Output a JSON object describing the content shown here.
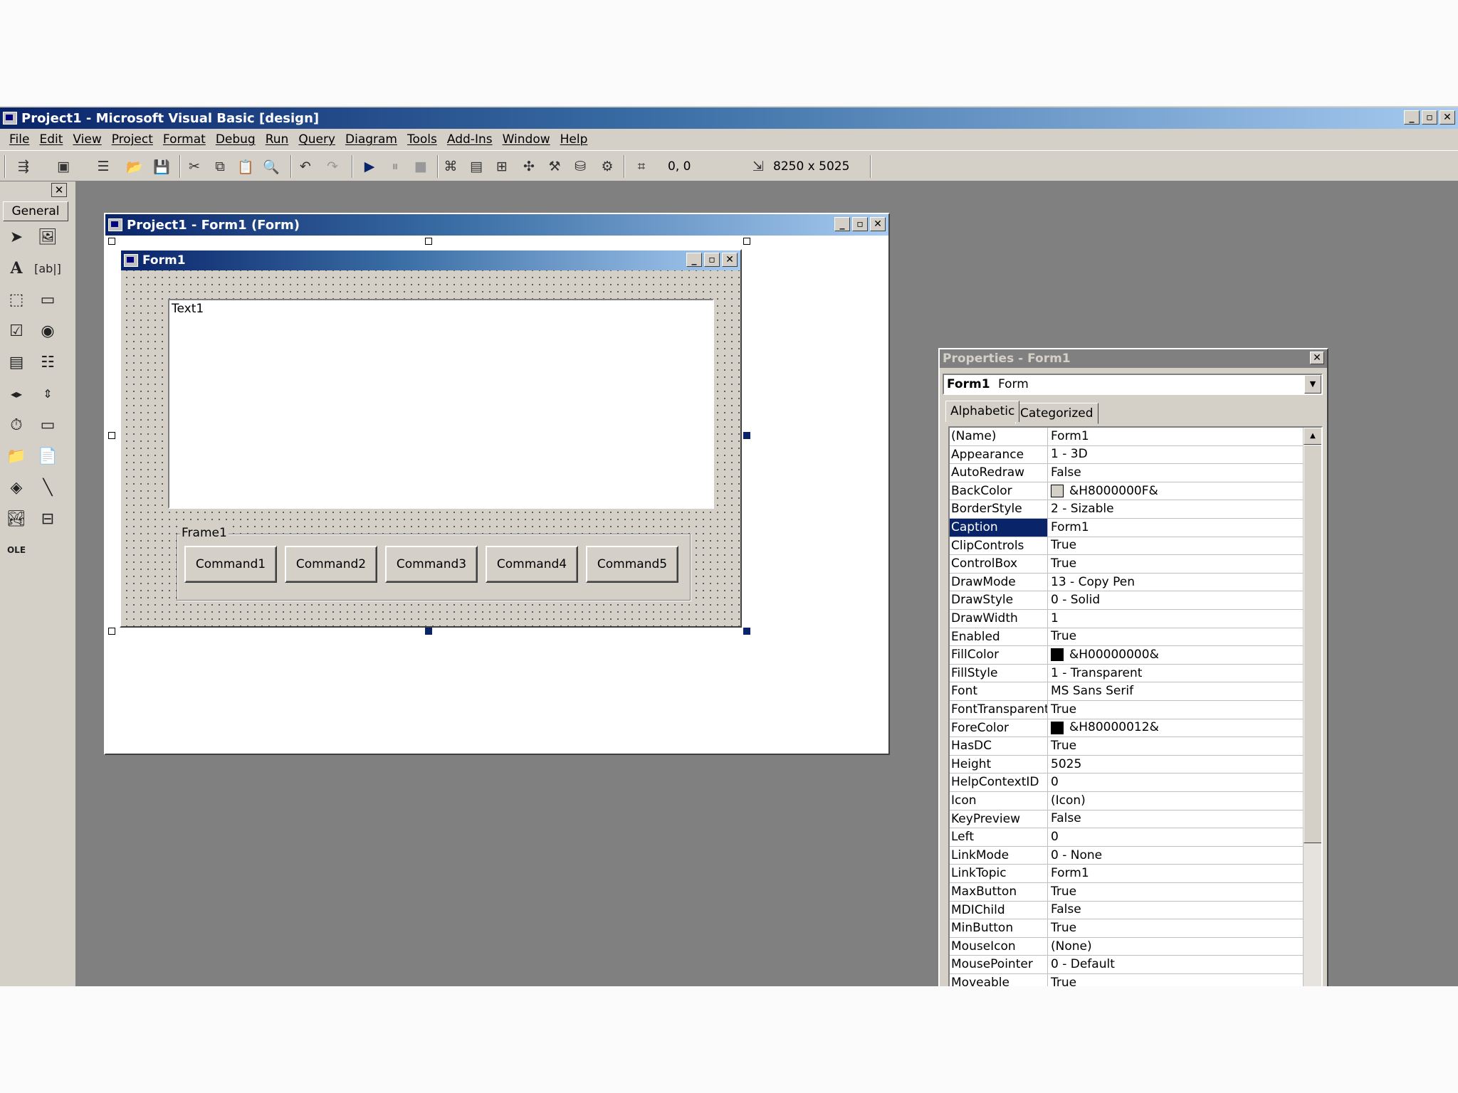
{
  "app": {
    "title": "Project1 - Microsoft Visual Basic [design]",
    "window_controls": [
      "_",
      "▫",
      "✕"
    ]
  },
  "menu": [
    "File",
    "Edit",
    "View",
    "Project",
    "Format",
    "Debug",
    "Run",
    "Query",
    "Diagram",
    "Tools",
    "Add-Ins",
    "Window",
    "Help"
  ],
  "toolbar": {
    "position_readout": "0, 0",
    "size_readout": "8250 x 5025"
  },
  "toolbox": {
    "tab_label": "General",
    "close_label": "✕"
  },
  "designer": {
    "title": "Project1 - Form1 (Form)",
    "form": {
      "title": "Form1",
      "textbox_text": "Text1",
      "frame_label": "Frame1",
      "buttons": [
        "Command1",
        "Command2",
        "Command3",
        "Command4",
        "Command5"
      ]
    }
  },
  "properties": {
    "title": "Properties - Form1",
    "object_name": "Form1",
    "object_type": "Form",
    "tabs": [
      "Alphabetic",
      "Categorized"
    ],
    "selected_property": "Caption",
    "rows": [
      {
        "name": "(Name)",
        "value": "Form1"
      },
      {
        "name": "Appearance",
        "value": "1 - 3D"
      },
      {
        "name": "AutoRedraw",
        "value": "False"
      },
      {
        "name": "BackColor",
        "value": "&H8000000F&",
        "swatch": "#d4d0c8"
      },
      {
        "name": "BorderStyle",
        "value": "2 - Sizable"
      },
      {
        "name": "Caption",
        "value": "Form1"
      },
      {
        "name": "ClipControls",
        "value": "True"
      },
      {
        "name": "ControlBox",
        "value": "True"
      },
      {
        "name": "DrawMode",
        "value": "13 - Copy Pen"
      },
      {
        "name": "DrawStyle",
        "value": "0 - Solid"
      },
      {
        "name": "DrawWidth",
        "value": "1"
      },
      {
        "name": "Enabled",
        "value": "True"
      },
      {
        "name": "FillColor",
        "value": "&H00000000&",
        "swatch": "#000000"
      },
      {
        "name": "FillStyle",
        "value": "1 - Transparent"
      },
      {
        "name": "Font",
        "value": "MS Sans Serif"
      },
      {
        "name": "FontTransparent",
        "value": "True"
      },
      {
        "name": "ForeColor",
        "value": "&H80000012&",
        "swatch": "#000000"
      },
      {
        "name": "HasDC",
        "value": "True"
      },
      {
        "name": "Height",
        "value": "5025"
      },
      {
        "name": "HelpContextID",
        "value": "0"
      },
      {
        "name": "Icon",
        "value": "(Icon)"
      },
      {
        "name": "KeyPreview",
        "value": "False"
      },
      {
        "name": "Left",
        "value": "0"
      },
      {
        "name": "LinkMode",
        "value": "0 - None"
      },
      {
        "name": "LinkTopic",
        "value": "Form1"
      },
      {
        "name": "MaxButton",
        "value": "True"
      },
      {
        "name": "MDIChild",
        "value": "False"
      },
      {
        "name": "MinButton",
        "value": "True"
      },
      {
        "name": "MouseIcon",
        "value": "(None)"
      },
      {
        "name": "MousePointer",
        "value": "0 - Default"
      },
      {
        "name": "Moveable",
        "value": "True"
      }
    ]
  },
  "colors": {
    "active_title_start": "#0a246a",
    "active_title_end": "#a6caf0",
    "inactive_title": "#808080",
    "face": "#d4d0c8",
    "workspace": "#808080"
  }
}
